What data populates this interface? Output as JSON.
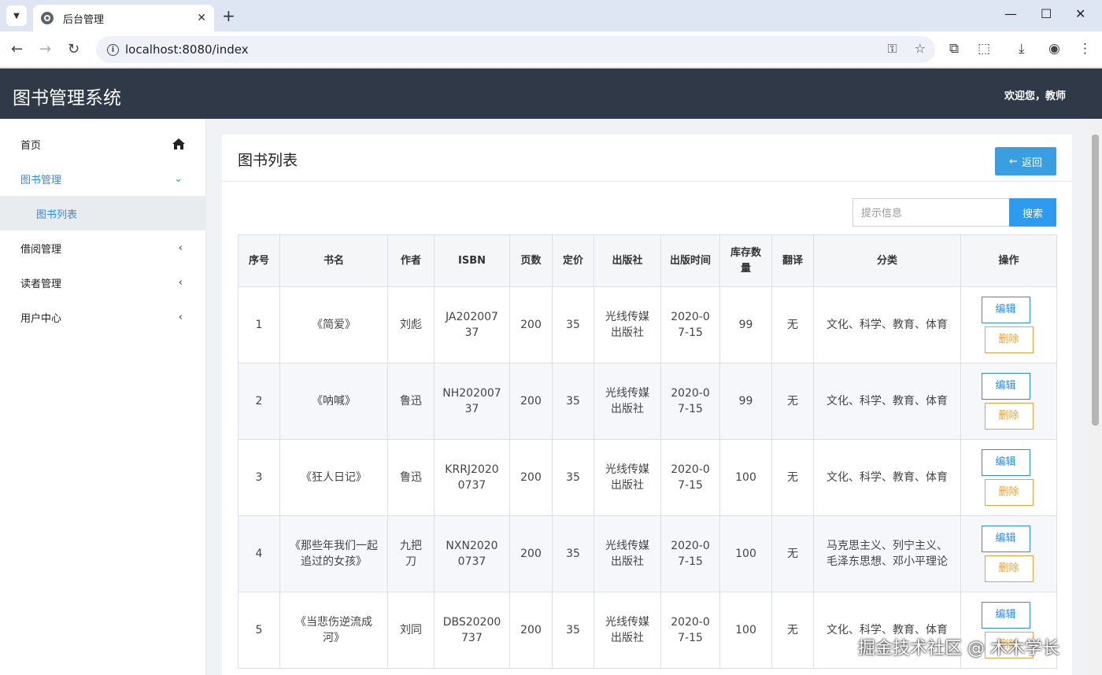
{
  "browser": {
    "tab_title": "后台管理",
    "url": "localhost:8080/index"
  },
  "header": {
    "title": "图书管理系统",
    "welcome": "欢迎您，教师"
  },
  "sidebar": {
    "items": [
      {
        "label": "首页"
      },
      {
        "label": "图书管理"
      },
      {
        "label": "图书列表"
      },
      {
        "label": "借阅管理"
      },
      {
        "label": "读者管理"
      },
      {
        "label": "用户中心"
      }
    ]
  },
  "panel": {
    "title": "图书列表",
    "back_label": "返回",
    "search_placeholder": "提示信息",
    "search_label": "搜索"
  },
  "table": {
    "headers": [
      "序号",
      "书名",
      "作者",
      "ISBN",
      "页数",
      "定价",
      "出版社",
      "出版时间",
      "库存数量",
      "翻译",
      "分类",
      "操作"
    ],
    "rows": [
      {
        "no": "1",
        "name": "《简爱》",
        "author": "刘彪",
        "isbn": "JA20200737",
        "pages": "200",
        "price": "35",
        "publisher": "光线传媒出版社",
        "date": "2020-07-15",
        "stock": "99",
        "translate": "无",
        "category": "文化、科学、教育、体育"
      },
      {
        "no": "2",
        "name": "《呐喊》",
        "author": "鲁迅",
        "isbn": "NH20200737",
        "pages": "200",
        "price": "35",
        "publisher": "光线传媒出版社",
        "date": "2020-07-15",
        "stock": "99",
        "translate": "无",
        "category": "文化、科学、教育、体育"
      },
      {
        "no": "3",
        "name": "《狂人日记》",
        "author": "鲁迅",
        "isbn": "KRRJ20200737",
        "pages": "200",
        "price": "35",
        "publisher": "光线传媒出版社",
        "date": "2020-07-15",
        "stock": "100",
        "translate": "无",
        "category": "文化、科学、教育、体育"
      },
      {
        "no": "4",
        "name": "《那些年我们一起追过的女孩》",
        "author": "九把刀",
        "isbn": "NXN20200737",
        "pages": "200",
        "price": "35",
        "publisher": "光线传媒出版社",
        "date": "2020-07-15",
        "stock": "100",
        "translate": "无",
        "category": "马克思主义、列宁主义、毛泽东思想、邓小平理论"
      },
      {
        "no": "5",
        "name": "《当悲伤逆流成河》",
        "author": "刘同",
        "isbn": "DBS20200737",
        "pages": "200",
        "price": "35",
        "publisher": "光线传媒出版社",
        "date": "2020-07-15",
        "stock": "100",
        "translate": "无",
        "category": "文化、科学、教育、体育"
      }
    ],
    "edit_label": "编辑",
    "delete_label": "删除"
  },
  "watermark": "掘金技术社区 @ 木木学长"
}
